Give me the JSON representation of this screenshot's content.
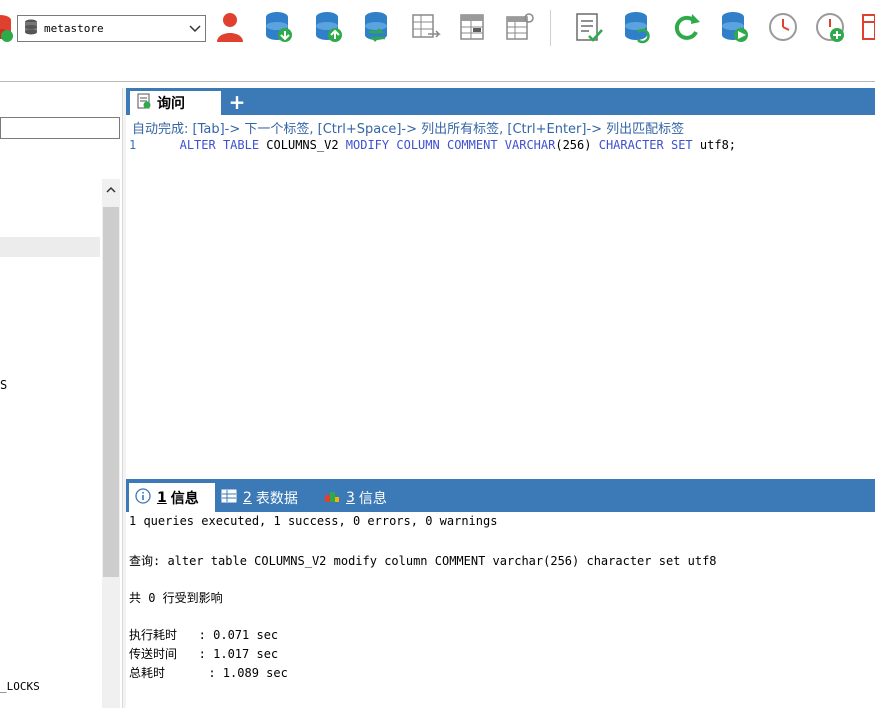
{
  "toolbar": {
    "database_select": {
      "value": "metastore"
    },
    "icons": [
      "new-connection-icon",
      "user-manager-icon",
      "backup-database-icon",
      "restore-database-icon",
      "sync-database-icon",
      "schema-sync-icon",
      "data-sync-icon",
      "table-designer-icon",
      "query-report-icon",
      "refresh-db-icon",
      "refresh-icon",
      "db-action-icon",
      "schedule-icon",
      "schedule-add-icon",
      "table-tool-icon"
    ]
  },
  "left_panel": {
    "visible_fragments": [
      "S",
      "_LOCKS"
    ]
  },
  "editor": {
    "tab_label": "询问",
    "add_tab": "+",
    "hint": "自动完成: [Tab]-> 下一个标签, [Ctrl+Space]-> 列出所有标签, [Ctrl+Enter]-> 列出匹配标签",
    "line_number": "1",
    "code_tokens": [
      {
        "t": "ALTER",
        "k": "kw"
      },
      {
        "t": " ",
        "k": "sp"
      },
      {
        "t": "TABLE",
        "k": "kw"
      },
      {
        "t": " COLUMNS_V2 ",
        "k": "id"
      },
      {
        "t": "MODIFY",
        "k": "kw"
      },
      {
        "t": " ",
        "k": "sp"
      },
      {
        "t": "COLUMN",
        "k": "kw"
      },
      {
        "t": " ",
        "k": "sp"
      },
      {
        "t": "COMMENT",
        "k": "kw"
      },
      {
        "t": " ",
        "k": "sp"
      },
      {
        "t": "VARCHAR",
        "k": "kw"
      },
      {
        "t": "(256) ",
        "k": "num"
      },
      {
        "t": "CHARACTER",
        "k": "kw"
      },
      {
        "t": " ",
        "k": "sp"
      },
      {
        "t": "SET",
        "k": "kw"
      },
      {
        "t": " utf8;",
        "k": "id"
      }
    ]
  },
  "output": {
    "tabs": [
      {
        "num": "1",
        "label": "信息",
        "icon": "info-icon"
      },
      {
        "num": "2",
        "label": "表数据",
        "icon": "table-grid-icon"
      },
      {
        "num": "3",
        "label": "信息",
        "icon": "info-color-icon"
      }
    ],
    "lines": {
      "summary": "1 queries executed, 1 success, 0 errors, 0 warnings",
      "query": "查询: alter table COLUMNS_V2 modify column COMMENT varchar(256) character set utf8",
      "affected": "共 0 行受到影响",
      "exec_time": "执行耗时   : 0.071 sec",
      "transfer_time": "传送时间   : 1.017 sec",
      "total_time": "总耗时      : 1.089 sec"
    }
  },
  "colors": {
    "tab_bar": "#3c7ab7",
    "keyword": "#3f51d1",
    "hint": "#3465a4",
    "icon_blue": "#2f80c8",
    "icon_green": "#2eaa4a",
    "icon_red": "#e0412e"
  }
}
